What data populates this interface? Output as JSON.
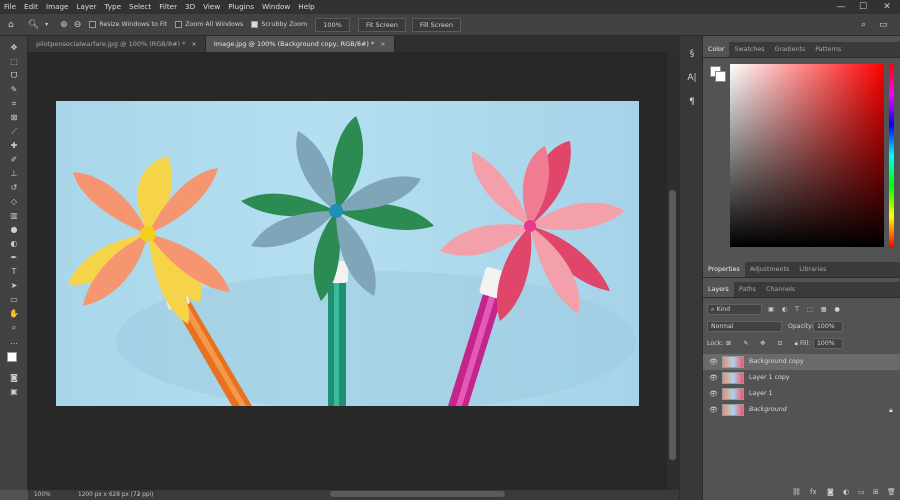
{
  "menu": [
    "File",
    "Edit",
    "Image",
    "Layer",
    "Type",
    "Select",
    "Filter",
    "3D",
    "View",
    "Plugins",
    "Window",
    "Help"
  ],
  "window_controls": {
    "minimize": "—",
    "maximize": "☐",
    "close": "✕"
  },
  "options": {
    "resize_windows": "Resize Windows to Fit",
    "zoom_all": "Zoom All Windows",
    "scrubby_zoom": "Scrubby Zoom",
    "zoom_value": "100%",
    "fit_screen": "Fit Screen",
    "fill_screen": "Fill Screen"
  },
  "tabs": [
    {
      "label": "pilotpensocialwarfare.jpg @ 100% (RGB/8#) *",
      "close": "×"
    },
    {
      "label": "Image.jpg @ 100% (Background copy, RGB/8#) *",
      "close": "×"
    }
  ],
  "status": {
    "zoom": "100%",
    "doc_info": "1200 px x 628 px (72 ppi)"
  },
  "color_panel": {
    "tabs": [
      "Color",
      "Swatches",
      "Gradients",
      "Patterns"
    ]
  },
  "properties_panel": {
    "tabs": [
      "Properties",
      "Adjustments",
      "Libraries"
    ]
  },
  "layers_panel": {
    "tabs": [
      "Layers",
      "Paths",
      "Channels"
    ],
    "filter_kind": "Kind",
    "blend_mode": "Normal",
    "opacity_label": "Opacity:",
    "opacity_value": "100%",
    "lock_label": "Lock:",
    "fill_label": "Fill:",
    "fill_value": "100%",
    "layers": [
      {
        "name": "Background copy",
        "selected": true,
        "italic": false
      },
      {
        "name": "Layer 1 copy",
        "selected": false,
        "italic": false
      },
      {
        "name": "Layer 1",
        "selected": false,
        "italic": false
      },
      {
        "name": "Background",
        "selected": false,
        "italic": true
      }
    ]
  },
  "colors": {
    "accent": "#1473e6",
    "panel_bg": "#535353",
    "canvas_bg": "#282828",
    "menubar_bg": "#323232"
  }
}
